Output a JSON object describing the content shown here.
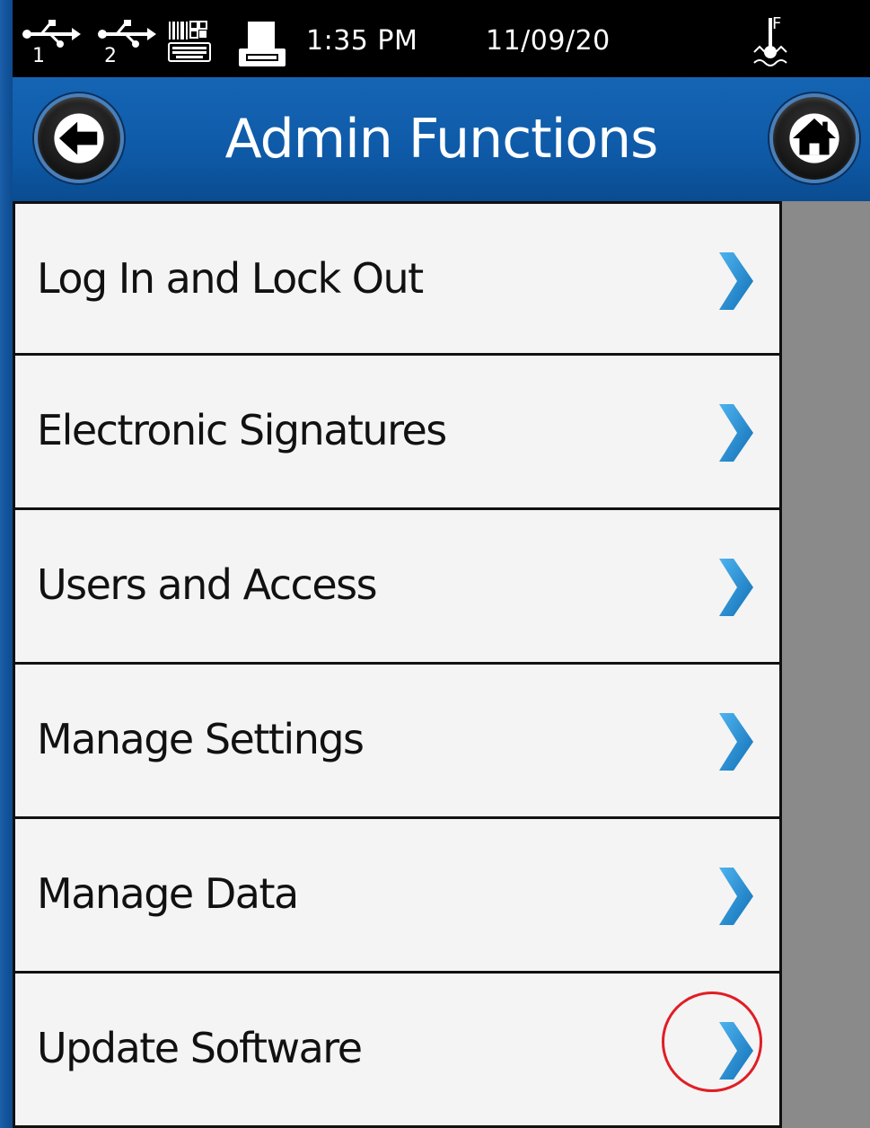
{
  "status_bar": {
    "usb1_label": "1",
    "usb2_label": "2",
    "time": "1:35 PM",
    "date": "11/09/20",
    "icons": [
      "usb-icon",
      "usb-icon",
      "barcode-keyboard-icon",
      "printer-icon",
      "temperature-icon"
    ]
  },
  "header": {
    "title": "Admin Functions",
    "back_icon": "arrow-left-icon",
    "home_icon": "home-icon"
  },
  "menu": {
    "items": [
      {
        "label": "Log In and Lock Out"
      },
      {
        "label": "Electronic Signatures"
      },
      {
        "label": "Users and Access"
      },
      {
        "label": "Manage Settings"
      },
      {
        "label": "Manage Data"
      },
      {
        "label": "Update Software"
      }
    ],
    "chevron_icon": "chevron-right-icon"
  },
  "colors": {
    "header_blue": "#0e5aa8",
    "chevron_blue": "#1a8fd6",
    "highlight_red": "#e01e24"
  }
}
